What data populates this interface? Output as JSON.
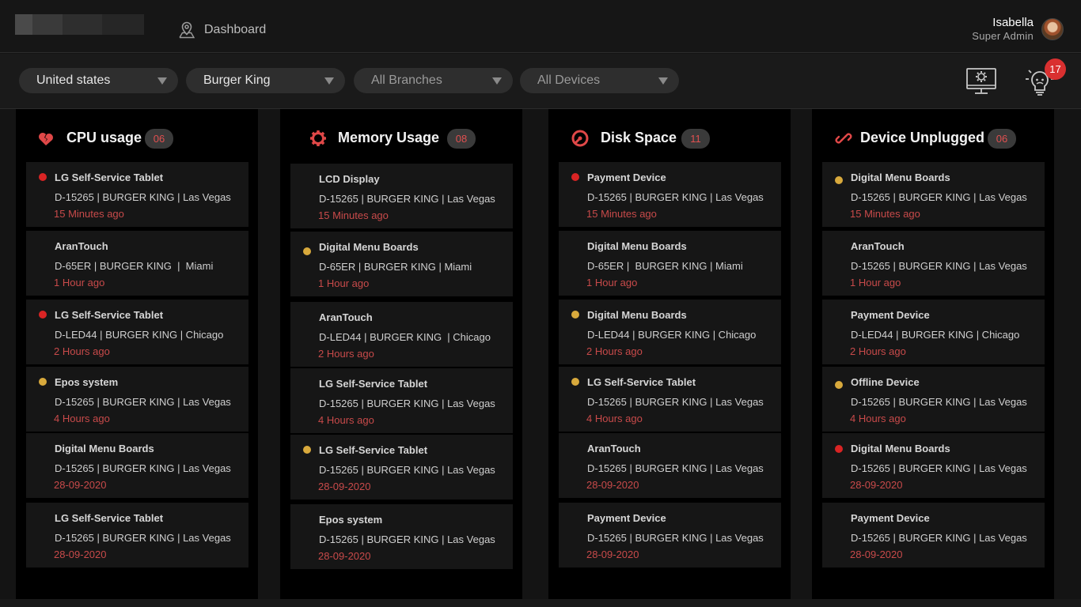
{
  "header": {
    "nav_dashboard": "Dashboard",
    "user_name": "Isabella",
    "user_role": "Super Admin"
  },
  "filters": [
    {
      "value": "United states",
      "dim": false
    },
    {
      "value": "Burger King",
      "dim": false
    },
    {
      "value": "All Branches",
      "dim": true
    },
    {
      "value": "All Devices",
      "dim": true
    }
  ],
  "notifications_count": "17",
  "colors": {
    "accent": "#d93030",
    "warning": "#d8a93c",
    "time": "#c84a4a"
  },
  "columns": [
    {
      "title": "CPU usage",
      "count": "06",
      "icon": "broken-heart-icon",
      "cards": [
        {
          "name": "LG Self-Service Tablet",
          "meta": "D-15265 | BURGER KING | Las Vegas",
          "time": "15 Minutes ago",
          "status": "red"
        },
        {
          "name": "AranTouch",
          "meta": "D-65ER | BURGER KING  |  Miami",
          "time": "1 Hour ago",
          "status": "none"
        },
        {
          "name": "LG Self-Service Tablet",
          "meta": "D-LED44 | BURGER KING | Chicago",
          "time": "2 Hours ago",
          "status": "red"
        },
        {
          "name": "Epos system",
          "meta": "D-15265 | BURGER KING | Las Vegas",
          "time": "4 Hours ago",
          "status": "yellow"
        },
        {
          "name": "Digital Menu Boards",
          "meta": "D-15265 | BURGER KING | Las Vegas",
          "time": "28-09-2020",
          "status": "none"
        },
        {
          "name": "LG Self-Service Tablet",
          "meta": "D-15265 | BURGER KING | Las Vegas",
          "time": "28-09-2020",
          "status": "none"
        }
      ]
    },
    {
      "title": "Memory Usage",
      "count": "08",
      "icon": "gear-icon",
      "cards": [
        {
          "name": "LCD Display",
          "meta": "D-15265 | BURGER KING | Las Vegas",
          "time": "15 Minutes ago",
          "status": "none"
        },
        {
          "name": "Digital Menu Boards",
          "meta": "D-65ER | BURGER KING | Miami",
          "time": "1 Hour ago",
          "status": "yellow"
        },
        {
          "name": "AranTouch",
          "meta": "D-LED44 | BURGER KING  | Chicago",
          "time": "2 Hours ago",
          "status": "none"
        },
        {
          "name": "LG Self-Service Tablet",
          "meta": "D-15265 | BURGER KING | Las Vegas",
          "time": "4 Hours ago",
          "status": "none"
        },
        {
          "name": "LG Self-Service Tablet",
          "meta": "D-15265 | BURGER KING | Las Vegas",
          "time": "28-09-2020",
          "status": "yellow"
        },
        {
          "name": "Epos system",
          "meta": "D-15265 | BURGER KING | Las Vegas",
          "time": "28-09-2020",
          "status": "none"
        }
      ]
    },
    {
      "title": "Disk Space",
      "count": "11",
      "icon": "disk-icon",
      "cards": [
        {
          "name": "Payment Device",
          "meta": "D-15265 | BURGER KING | Las Vegas",
          "time": "15 Minutes ago",
          "status": "red"
        },
        {
          "name": "Digital Menu Boards",
          "meta": "D-65ER |  BURGER KING | Miami",
          "time": "1 Hour ago",
          "status": "none"
        },
        {
          "name": "Digital Menu Boards",
          "meta": "D-LED44 | BURGER KING | Chicago",
          "time": "2 Hours ago",
          "status": "yellow"
        },
        {
          "name": "LG Self-Service Tablet",
          "meta": "D-15265 | BURGER KING | Las Vegas",
          "time": "4 Hours ago",
          "status": "yellow"
        },
        {
          "name": "AranTouch",
          "meta": "D-15265 | BURGER KING | Las Vegas",
          "time": "28-09-2020",
          "status": "none"
        },
        {
          "name": "Payment Device",
          "meta": "D-15265 | BURGER KING | Las Vegas",
          "time": "28-09-2020",
          "status": "none"
        }
      ]
    },
    {
      "title": "Device Unplugged",
      "count": "06",
      "icon": "link-icon",
      "cards": [
        {
          "name": "Digital Menu Boards",
          "meta": "D-15265 | BURGER KING | Las Vegas",
          "time": "15 Minutes ago",
          "status": "yellow"
        },
        {
          "name": "AranTouch",
          "meta": "D-15265 | BURGER KING | Las Vegas",
          "time": "1 Hour ago",
          "status": "none"
        },
        {
          "name": "Payment Device",
          "meta": "D-LED44 | BURGER KING | Chicago",
          "time": "2 Hours ago",
          "status": "none"
        },
        {
          "name": "Offline Device",
          "meta": "D-15265 | BURGER KING | Las Vegas",
          "time": "4 Hours ago",
          "status": "yellow"
        },
        {
          "name": "Digital Menu Boards",
          "meta": "D-15265 | BURGER KING | Las Vegas",
          "time": "28-09-2020",
          "status": "red"
        },
        {
          "name": "Payment Device",
          "meta": "D-15265 | BURGER KING | Las Vegas",
          "time": "28-09-2020",
          "status": "none"
        }
      ]
    }
  ]
}
